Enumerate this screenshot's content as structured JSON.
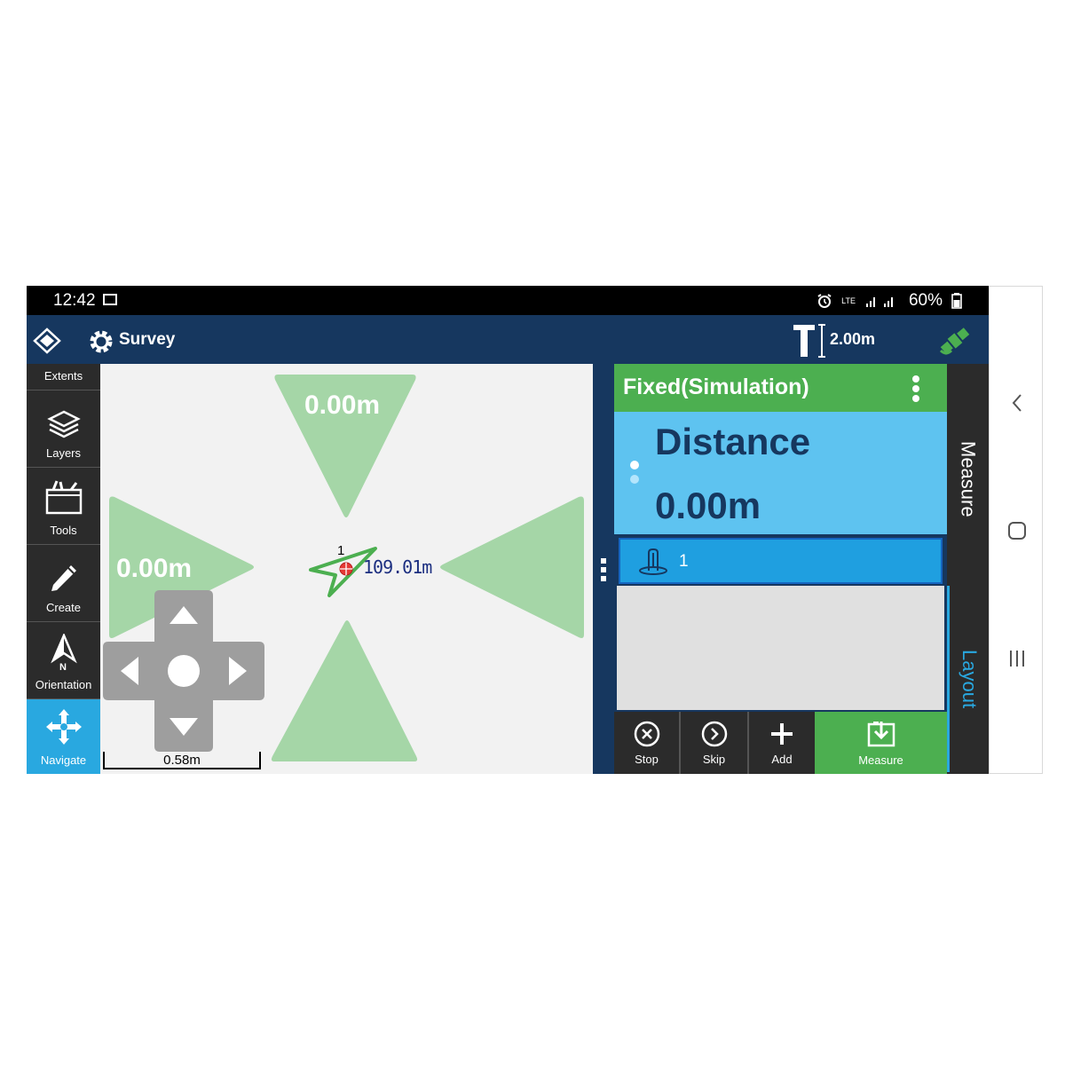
{
  "status_bar": {
    "time": "12:42",
    "battery": "60%",
    "network": "LTE"
  },
  "app_bar": {
    "title": "Survey",
    "pole_height": "2.00m",
    "icons": [
      "layers-logo-icon",
      "gear-icon",
      "pole-icon",
      "satellite-icon"
    ]
  },
  "left_toolbar": {
    "items": [
      {
        "label": "Extents",
        "icon": "extents-icon"
      },
      {
        "label": "Layers",
        "icon": "layers-icon"
      },
      {
        "label": "Tools",
        "icon": "toolbox-icon"
      },
      {
        "label": "Create",
        "icon": "pencil-icon"
      },
      {
        "label": "Orientation",
        "icon": "north-arrow-icon"
      },
      {
        "label": "Navigate",
        "icon": "move-icon",
        "active": true
      }
    ]
  },
  "map": {
    "top_offset": "0.00m",
    "left_offset": "0.00m",
    "point_number": "1",
    "point_distance": "109.01m",
    "scale": "0.58m"
  },
  "right_panel": {
    "status": "Fixed(Simulation)",
    "metric_label": "Distance",
    "metric_value": "0.00m",
    "point_row_number": "1",
    "buttons": {
      "stop": "Stop",
      "skip": "Skip",
      "add": "Add",
      "measure": "Measure"
    },
    "tabs": {
      "measure": "Measure",
      "layout": "Layout"
    }
  },
  "colors": {
    "app_bar": "#16375f",
    "green": "#4caf50",
    "light_blue": "#5ec3f0",
    "accent_blue": "#29a8e0",
    "triangle_green": "#a5d6a7"
  }
}
